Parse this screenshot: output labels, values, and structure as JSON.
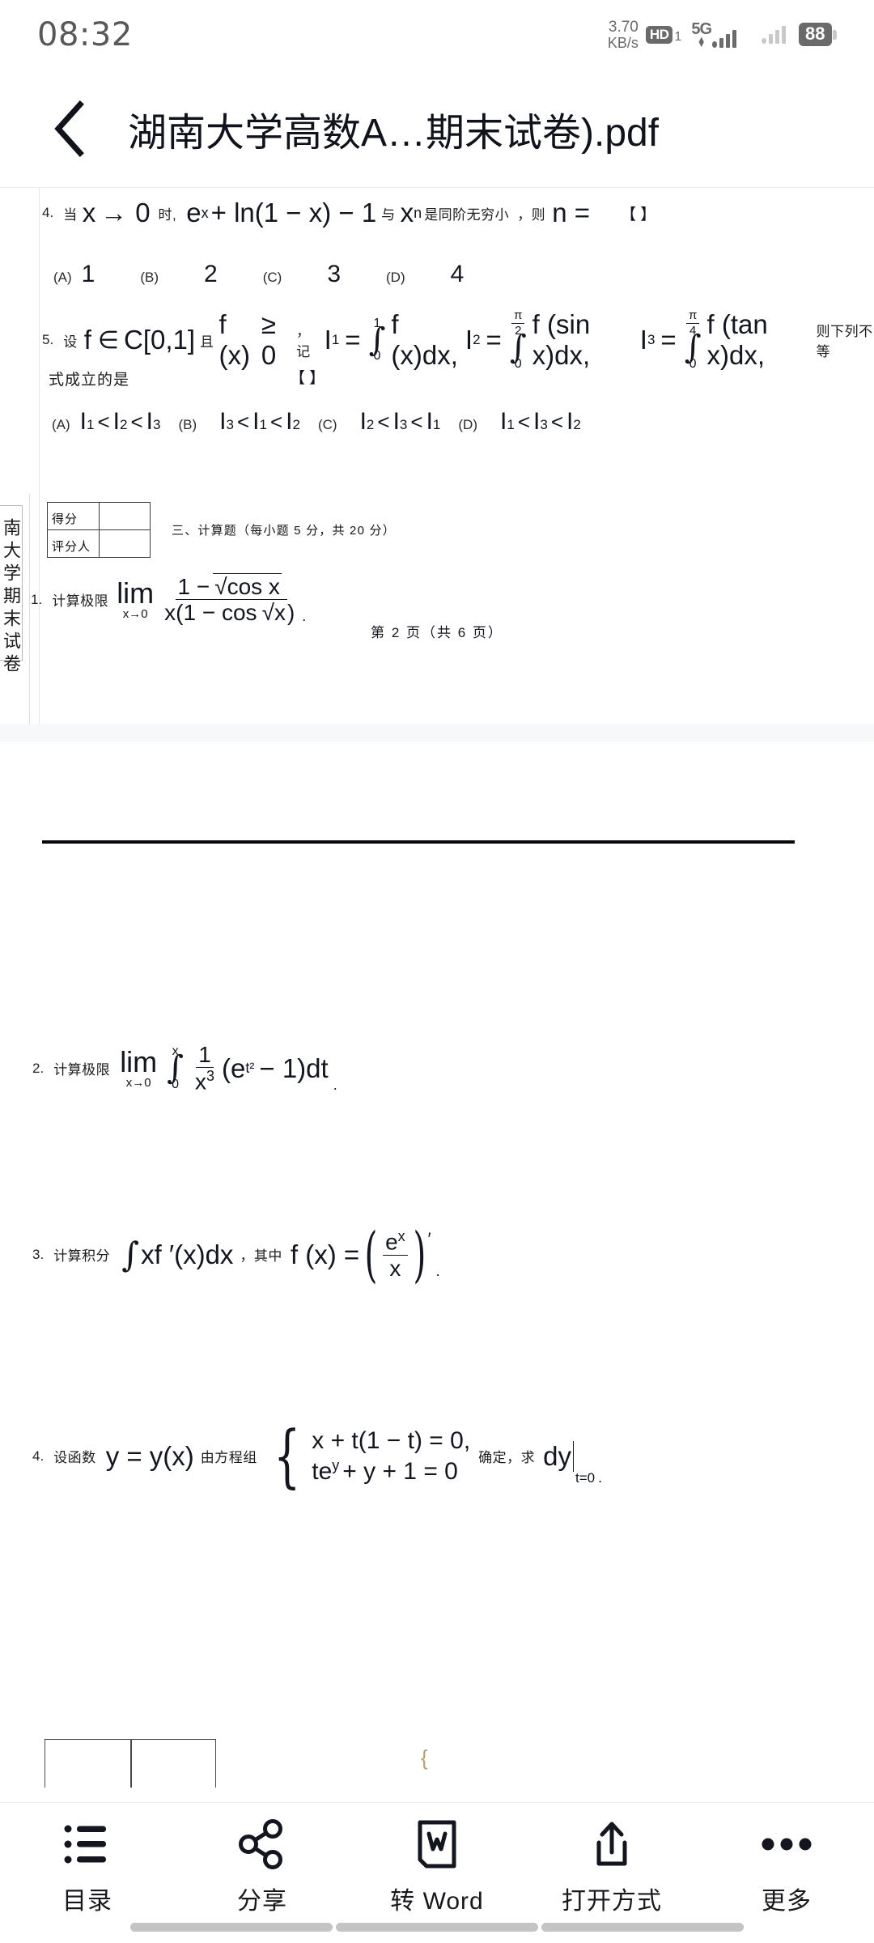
{
  "statusbar": {
    "time": "08:32",
    "net_speed_value": "3.70",
    "net_speed_unit": "KB/s",
    "hd_badge": "HD",
    "hd_sub": "1",
    "network_type": "5G",
    "battery_level": "88"
  },
  "titlebar": {
    "back_icon": "chevron-left-icon",
    "document_title": "湖南大学高数A…期末试卷).pdf"
  },
  "document": {
    "page1": {
      "q4": {
        "number": "4.",
        "lead": "当",
        "var": "x",
        "arrow": "→",
        "limit": "0",
        "when": "时,",
        "expr_base": "e",
        "expr_sup": "x",
        "expr_mid": "+ ln(1 − x) − 1",
        "compare": "与",
        "x_sym": "x",
        "x_sup": "n",
        "tail": "是同阶无穷小",
        "comma": "，则",
        "n_eq": "n =",
        "bracket": "【     】",
        "options": [
          {
            "tag": "(A)",
            "value": "1"
          },
          {
            "tag": "(B)",
            "value": "2"
          },
          {
            "tag": "(C)",
            "value": "3"
          },
          {
            "tag": "(D)",
            "value": "4"
          }
        ]
      },
      "q5": {
        "number": "5.",
        "lead": "设",
        "f": "f",
        "in": "∈",
        "space": "C[0,1]",
        "and": "且",
        "fx": "f (x)",
        "ge": "≥ 0",
        "note": "，记",
        "I1": "I",
        "I1sub": "1",
        "eq": "=",
        "i1_up": "1",
        "i1_lo": "0",
        "i1_body": "f (x)dx,",
        "I2": "I",
        "I2sub": "2",
        "i2_up_num": "π",
        "i2_up_den": "2",
        "i2_lo": "0",
        "i2_body": "f (sin x)dx,",
        "I3": "I",
        "I3sub": "3",
        "i3_up_num": "π",
        "i3_up_den": "4",
        "i3_lo": "0",
        "i3_body": "f (tan x)dx,",
        "tail": "则下列不等",
        "line2": "式成立的是",
        "bracket": "【     】",
        "options": [
          {
            "tag": "(A)",
            "a": "1",
            "b": "2",
            "c": "3"
          },
          {
            "tag": "(B)",
            "a": "3",
            "b": "1",
            "c": "2"
          },
          {
            "tag": "(C)",
            "a": "2",
            "b": "3",
            "c": "1"
          },
          {
            "tag": "(D)",
            "a": "1",
            "b": "3",
            "c": "2"
          }
        ],
        "option_sym": "I",
        "lt": "<"
      },
      "score_table": {
        "row1": "得分",
        "row2": "评分人"
      },
      "section3_title": "三、计算题（每小题    5 分，共  20 分）",
      "q1": {
        "number": "1.",
        "label": "计算极限",
        "lim": "lim",
        "limsub": "x→0",
        "num_a": "1 −",
        "num_sqrt": "cos x",
        "den_a": "x(1 − cos",
        "den_sqrt": "x",
        "den_b": ")",
        "period": "."
      },
      "footer": "第  2  页（共   6  页）",
      "side_vertical": "南大学期末试卷"
    },
    "page2": {
      "q2": {
        "number": "2.",
        "label": "计算极限",
        "lim": "lim",
        "limsub": "x→0",
        "int_up": "x",
        "int_lo": "0",
        "frac_num": "1",
        "frac_den_base": "x",
        "frac_den_sup": "3",
        "body_a": "(e",
        "body_sup": "t²",
        "body_b": "− 1)dt",
        "period": "."
      },
      "q3": {
        "number": "3.",
        "label": "计算积分",
        "integral": "∫",
        "body": "xf ′(x)dx",
        "where": "，其中",
        "fx": "f (x) =",
        "frac_num_base": "e",
        "frac_num_sup": "x",
        "frac_den": "x",
        "prime": "′",
        "period": "."
      },
      "q4": {
        "number": "4.",
        "label": "设函数",
        "yx": "y = y(x)",
        "by": "由方程组",
        "eq1": "x + t(1 − t) = 0,",
        "eq2_a": "te",
        "eq2_sup": "y",
        "eq2_b": "+ y + 1 = 0",
        "determine": "确定，求",
        "dy": "dy",
        "dy_sub": "t=0",
        "period": "."
      }
    }
  },
  "toolbar": {
    "items": [
      {
        "icon": "list-icon",
        "label": "目录"
      },
      {
        "icon": "share-icon",
        "label": "分享"
      },
      {
        "icon": "word-doc-icon",
        "label": "转 Word"
      },
      {
        "icon": "open-with-upload-icon",
        "label": "打开方式"
      },
      {
        "icon": "more-dots-icon",
        "label": "更多"
      }
    ]
  },
  "colors": {
    "background": "#ffffff",
    "page_gap": "#f7f8fa",
    "text_primary": "#13161f",
    "status_gray": "#6a6a6a",
    "nav_bar": "#c4c4c4"
  }
}
